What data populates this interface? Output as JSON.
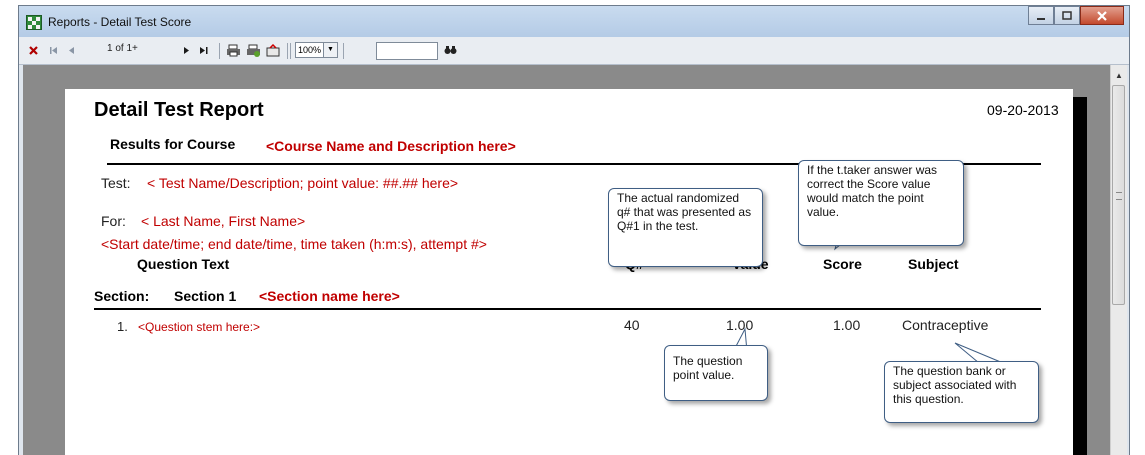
{
  "window": {
    "title": "Reports - Detail Test Score",
    "controls": {
      "minimize": "minimize-icon",
      "maximize": "maximize-icon",
      "close": "close-icon"
    }
  },
  "toolbar": {
    "page_indicator": "1 of 1+",
    "zoom_value": "100%",
    "search_value": ""
  },
  "report": {
    "title": "Detail Test Report",
    "date": "09-20-2013",
    "results_label": "Results for Course",
    "course_placeholder": "<Course Name and Description here>",
    "test_label": "Test:",
    "test_placeholder": "< Test Name/Description; point value: ##.## here>",
    "for_label": "For:",
    "for_placeholder": "< Last Name, First Name>",
    "attempt_placeholder": "<Start date/time; end date/time, time taken (h:m:s), attempt #>",
    "columns": {
      "question": "Question Text",
      "qnum": "Q#",
      "value": "Value",
      "score": "Score",
      "subject": "Subject"
    },
    "section_label": "Section:",
    "section_name": "Section 1",
    "section_placeholder": "<Section name here>",
    "rows": [
      {
        "num": "1.",
        "stem": "<Question stem here:>",
        "qnum": "40",
        "value": "1.00",
        "score": "1.00",
        "subject": "Contraceptive"
      }
    ]
  },
  "callouts": {
    "qnum": "The actual randomized q# that was presented as Q#1 in the test.",
    "score": "If the t.taker answer was correct the Score value would match the point value.",
    "value": "The question point value.",
    "subject": "The question bank or subject associated with this question."
  },
  "colors": {
    "placeholder": "#c00000",
    "callout_border": "#3f5e84",
    "titlebar": "#b4cbe6"
  }
}
